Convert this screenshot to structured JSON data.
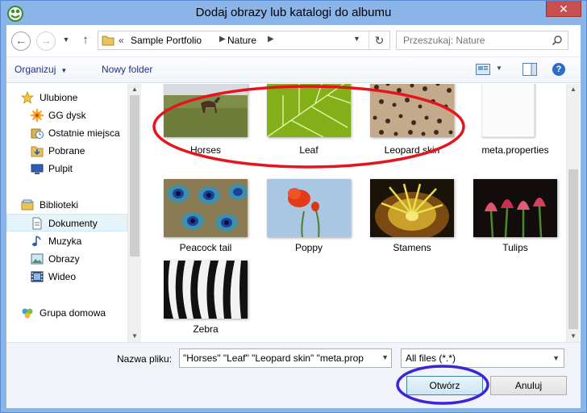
{
  "window": {
    "title": "Dodaj obrazy lub katalogi do albumu",
    "close_label": "✕"
  },
  "address": {
    "overflow": "«",
    "crumbs": [
      "Sample Portfolio",
      "Nature"
    ],
    "separator": "▶",
    "search_placeholder": "Przeszukaj: Nature"
  },
  "toolbar": {
    "organize_label": "Organizuj",
    "new_folder_label": "Nowy folder",
    "help_label": "?"
  },
  "nav": {
    "items": [
      {
        "label": "Ulubione",
        "icon": "star-icon"
      },
      {
        "label": "GG dysk",
        "icon": "gg-icon"
      },
      {
        "label": "Ostatnie miejsca",
        "icon": "recent-places-icon"
      },
      {
        "label": "Pobrane",
        "icon": "download-folder-icon"
      },
      {
        "label": "Pulpit",
        "icon": "desktop-icon"
      },
      {
        "label": "Biblioteki",
        "icon": "libraries-icon"
      },
      {
        "label": "Dokumenty",
        "icon": "documents-icon"
      },
      {
        "label": "Muzyka",
        "icon": "music-icon"
      },
      {
        "label": "Obrazy",
        "icon": "pictures-icon"
      },
      {
        "label": "Wideo",
        "icon": "video-icon"
      },
      {
        "label": "Grupa domowa",
        "icon": "homegroup-icon"
      }
    ],
    "selected": "Dokumenty"
  },
  "files": [
    {
      "name": "Horses",
      "selected": true
    },
    {
      "name": "Leaf",
      "selected": true
    },
    {
      "name": "Leopard skin",
      "selected": true
    },
    {
      "name": "meta.properties",
      "selected": true
    },
    {
      "name": "Peacock tail",
      "selected": false
    },
    {
      "name": "Poppy",
      "selected": false
    },
    {
      "name": "Stamens",
      "selected": false
    },
    {
      "name": "Tulips",
      "selected": false
    },
    {
      "name": "Zebra",
      "selected": false
    }
  ],
  "bottom": {
    "filename_label": "Nazwa pliku:",
    "filename_value": "\"Horses\" \"Leaf\" \"Leopard skin\" \"meta.prop",
    "filter_value": "All files (*.*)",
    "open_label": "Otwórz",
    "cancel_label": "Anuluj"
  },
  "colors": {
    "title_bar": "#8bb5e8",
    "close_button": "#c74f4f",
    "annotation_red": "#e3151f",
    "annotation_blue": "#3b25d6",
    "link_text": "#1e3287"
  }
}
